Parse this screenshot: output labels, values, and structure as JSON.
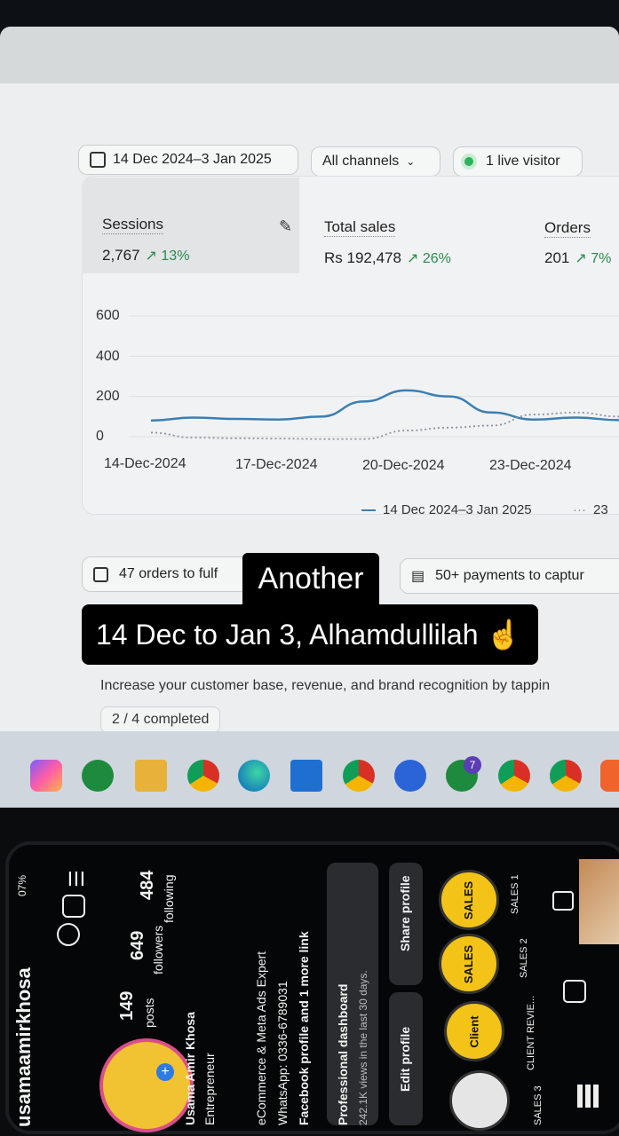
{
  "filter_bar": {
    "date_range": "14 Dec 2024–3 Jan 2025",
    "channel": "All channels",
    "live_visitors": "1 live visitor"
  },
  "metrics": [
    {
      "label": "Sessions",
      "value": "2,767",
      "change": "13%"
    },
    {
      "label": "Total sales",
      "value": "Rs 192,478",
      "change": "26%"
    },
    {
      "label": "Orders",
      "value": "201",
      "change": "7%"
    }
  ],
  "chart_data": {
    "type": "line",
    "y_ticks": [
      "600",
      "400",
      "200",
      "0"
    ],
    "x_ticks": [
      "14-Dec-2024",
      "17-Dec-2024",
      "20-Dec-2024",
      "23-Dec-2024"
    ],
    "ylim": [
      0,
      600
    ],
    "series": [
      {
        "name": "14 Dec 2024–3 Jan 2025",
        "style": "solid",
        "color": "#3a7fb3",
        "x": [
          "14-Dec",
          "15-Dec",
          "16-Dec",
          "17-Dec",
          "18-Dec",
          "19-Dec",
          "20-Dec",
          "21-Dec",
          "22-Dec",
          "23-Dec",
          "24-Dec",
          "25-Dec"
        ],
        "y": [
          80,
          95,
          88,
          85,
          100,
          175,
          230,
          200,
          120,
          85,
          95,
          82
        ]
      },
      {
        "name": "23",
        "style": "dotted",
        "color": "#8a93a0",
        "x": [
          "14-Dec",
          "15-Dec",
          "16-Dec",
          "17-Dec",
          "18-Dec",
          "19-Dec",
          "20-Dec",
          "21-Dec",
          "22-Dec",
          "23-Dec",
          "24-Dec",
          "25-Dec"
        ],
        "y": [
          20,
          -5,
          -8,
          -10,
          -12,
          -12,
          30,
          45,
          55,
          110,
          120,
          100
        ]
      }
    ],
    "legend": {
      "current": "14 Dec 2024–3 Jan 2025",
      "previous": "23"
    }
  },
  "actions": {
    "orders_to_fulfill": "47 orders to fulf",
    "payments": "50+ payments to captur"
  },
  "setup": {
    "text": "Increase your customer base, revenue, and brand recognition by tappin",
    "progress": "2 / 4 completed"
  },
  "captions": {
    "line1": "Another",
    "line2": "14 Dec to Jan 3, Alhamdullilah ☝"
  },
  "taskbar_icons": [
    "copilot-icon",
    "whatsapp-icon",
    "file-explorer-icon",
    "chrome-icon",
    "edge-icon",
    "store-icon",
    "chrome-red-icon",
    "chrome-blue-icon",
    "whatsapp-badge-icon",
    "chrome-profile-icon",
    "chrome-profile-2-icon",
    "app-orange-icon"
  ],
  "whatsapp_badge": "7",
  "phone": {
    "username": "usamaamirkhosa",
    "posts_count": "149",
    "posts_label": "posts",
    "followers_count": "649",
    "followers_label": "followers",
    "following_count": "484",
    "following_label": "following",
    "bio_name": "Usama Amir Khosa",
    "bio_line1": "Entrepreneur",
    "bio_line2": "eCommerce & Meta Ads Expert",
    "bio_line3": "WhatsApp: 0336-6789031",
    "bio_line4": "Facebook profile and 1 more link",
    "dashboard_title": "Professional dashboard",
    "dashboard_sub": "242.1K views in the last 30 days.",
    "edit_profile": "Edit profile",
    "share_profile": "Share profile",
    "highlights": [
      "SALES 1",
      "SALES 2",
      "CLIENT REVIE...",
      "SALES 3"
    ],
    "highlight_badges": [
      "SALES",
      "SALES",
      "Client"
    ],
    "status": "07%"
  }
}
